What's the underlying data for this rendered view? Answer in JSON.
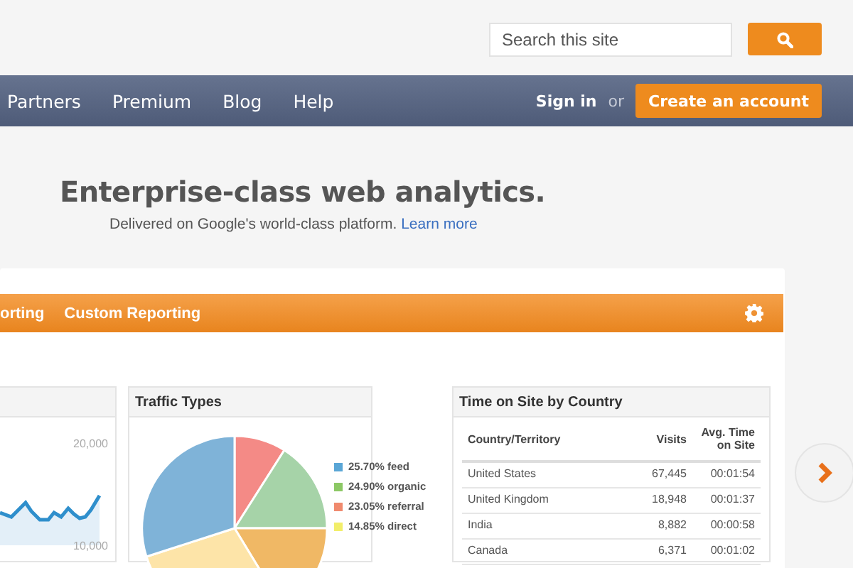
{
  "search": {
    "placeholder": "Search this site"
  },
  "nav": {
    "items": [
      "Partners",
      "Premium",
      "Blog",
      "Help"
    ],
    "sign_in": "Sign in",
    "or": "or",
    "create_account": "Create an account"
  },
  "hero": {
    "title": "Enterprise-class web analytics.",
    "subtitle": "Delivered on Google's world-class platform.",
    "link": "Learn more"
  },
  "report_bar": {
    "items": [
      "orting",
      "Custom Reporting"
    ]
  },
  "line_panel": {
    "ticks": [
      "20,000",
      "10,000"
    ]
  },
  "traffic_types": {
    "title": "Traffic Types",
    "legend": [
      {
        "label": "25.70% feed",
        "color": "#5aa6d6"
      },
      {
        "label": "24.90% organic",
        "color": "#8cc865"
      },
      {
        "label": "23.05% referral",
        "color": "#f08a6e"
      },
      {
        "label": "14.85% direct",
        "color": "#f2ee6a"
      }
    ]
  },
  "time_on_site": {
    "title": "Time on Site by Country",
    "columns": [
      "Country/Territory",
      "Visits",
      "Avg. Time on Site"
    ],
    "rows": [
      [
        "United States",
        "67,445",
        "00:01:54"
      ],
      [
        "United Kingdom",
        "18,948",
        "00:01:37"
      ],
      [
        "India",
        "8,882",
        "00:00:58"
      ],
      [
        "Canada",
        "6,371",
        "00:01:02"
      ]
    ]
  }
}
